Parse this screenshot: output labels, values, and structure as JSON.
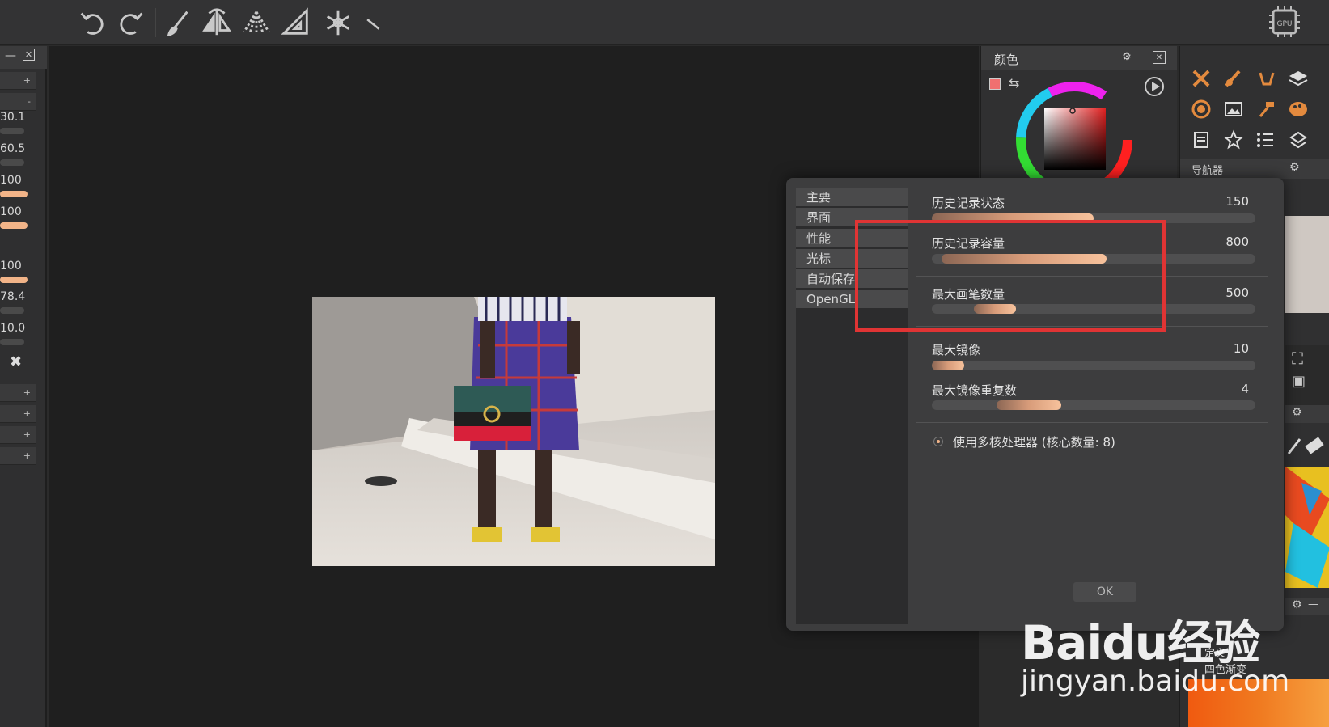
{
  "app": {
    "gpu_badge": "GPU"
  },
  "toolbar": {
    "icons": [
      "undo-icon",
      "redo-icon",
      "brush-icon",
      "mirror-icon",
      "perspective-icon",
      "ruler-triangle-icon",
      "snowflake-icon",
      "measure-icon"
    ]
  },
  "left_panel": {
    "values": [
      "30.1",
      "60.5",
      "100",
      "100",
      "100",
      "78.4",
      "10.0"
    ],
    "value_fractions": [
      0.0,
      0.0,
      1.0,
      1.0,
      1.0,
      0.0,
      0.0
    ],
    "buttons": [
      "+",
      "-",
      "+",
      "+",
      "+",
      "+"
    ]
  },
  "color_panel": {
    "title": "颜色"
  },
  "navigator_panel": {
    "title": "导航器"
  },
  "gradient_panel": {
    "label_1": "定义",
    "label_2": "四色渐变"
  },
  "dialog": {
    "nav": [
      "主要",
      "界面",
      "性能",
      "光标",
      "自动保存",
      "OpenGL"
    ],
    "settings": [
      {
        "label": "历史记录状态",
        "value": "150",
        "fill_start": 0.0,
        "fill_end": 0.5
      },
      {
        "label": "历史记录容量",
        "value": "800",
        "fill_start": 0.03,
        "fill_end": 0.54
      },
      {
        "label": "最大画笔数量",
        "value": "500",
        "fill_start": 0.13,
        "fill_end": 0.26
      },
      {
        "label": "最大镜像",
        "value": "10",
        "fill_start": 0.0,
        "fill_end": 0.1
      },
      {
        "label": "最大镜像重复数",
        "value": "4",
        "fill_start": 0.2,
        "fill_end": 0.4
      }
    ],
    "multicore_label": "使用多核处理器 (核心数量: 8)",
    "ok_label": "OK"
  },
  "watermark": {
    "main": "Baidu经验",
    "sub": "jingyan.baidu.com"
  },
  "colors": {
    "accent": "#f2b488",
    "highlight": "#e03434",
    "background": "#2b2b2b"
  }
}
